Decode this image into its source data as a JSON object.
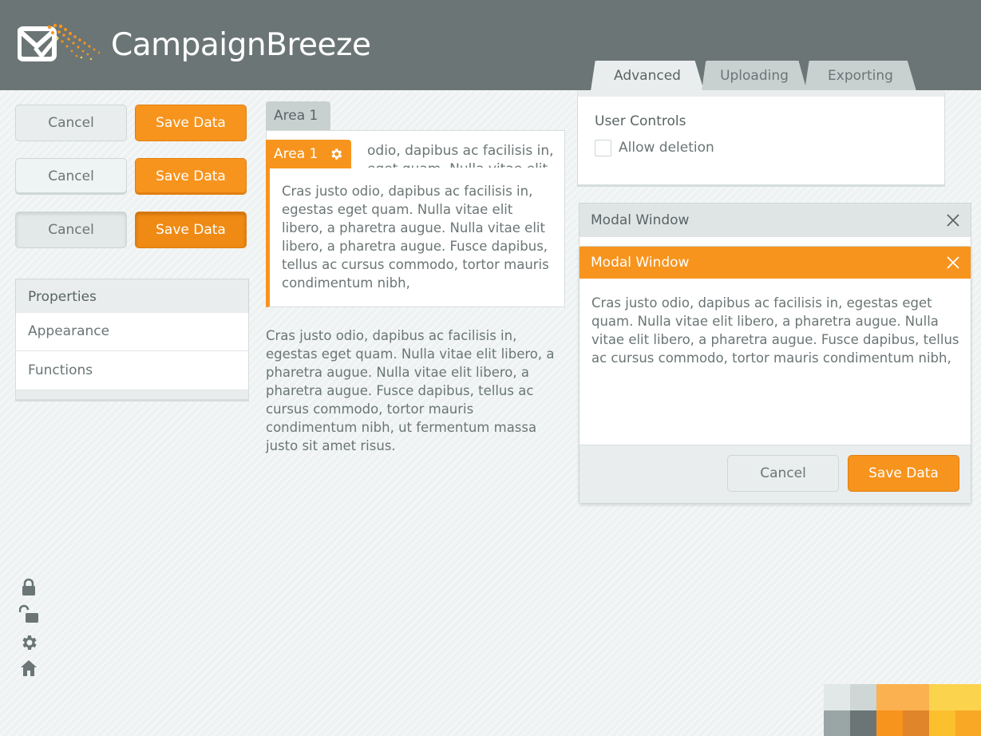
{
  "app": {
    "title": "CampaignBreeze"
  },
  "tabs": [
    {
      "label": "Advanced",
      "active": true
    },
    {
      "label": "Uploading",
      "active": false
    },
    {
      "label": "Exporting",
      "active": false
    }
  ],
  "user_controls": {
    "title": "User Controls",
    "checkbox_label": "Allow deletion",
    "checked": false
  },
  "button_rows": [
    {
      "state": "normal",
      "cancel": "Cancel",
      "save": "Save Data"
    },
    {
      "state": "hover",
      "cancel": "Cancel",
      "save": "Save Data"
    },
    {
      "state": "pressed",
      "cancel": "Cancel",
      "save": "Save Data"
    }
  ],
  "properties": {
    "title": "Properties",
    "items": [
      "Appearance",
      "Functions"
    ]
  },
  "area_back": {
    "tab": "Area 1",
    "text": "odio, dapibus ac facilisis in, eget quam. Nulla vitae elit"
  },
  "area_front": {
    "tab": "Area 1",
    "text": "Cras justo odio, dapibus ac facilisis in, egestas eget quam. Nulla vitae elit libero, a pharetra augue. Nulla vitae elit libero, a pharetra augue. Fusce dapibus, tellus ac cursus commodo, tortor mauris condimentum nibh,"
  },
  "free_text": "Cras justo odio, dapibus ac facilisis in, egestas eget quam. Nulla vitae elit libero, a pharetra augue. Nulla vitae elit libero, a pharetra augue. Fusce dapibus, tellus ac cursus commodo, tortor mauris condimentum nibh, ut fermentum massa justo sit amet risus.",
  "modal_back": {
    "title": "Modal Window"
  },
  "modal_front": {
    "title": "Modal Window",
    "text": "Cras justo odio, dapibus ac facilisis in, egestas eget quam. Nulla vitae elit libero, a pharetra augue. Nulla vitae elit libero, a pharetra augue. Fusce dapibus, tellus ac cursus commodo, tortor mauris condimentum nibh,",
    "cancel": "Cancel",
    "save": "Save Data"
  },
  "side_icons": [
    "lock-icon",
    "unlock-icon",
    "gear-icon",
    "home-icon"
  ],
  "colors": {
    "accent": "#f7941d",
    "header": "#6b7575",
    "text": "#6b7575"
  }
}
